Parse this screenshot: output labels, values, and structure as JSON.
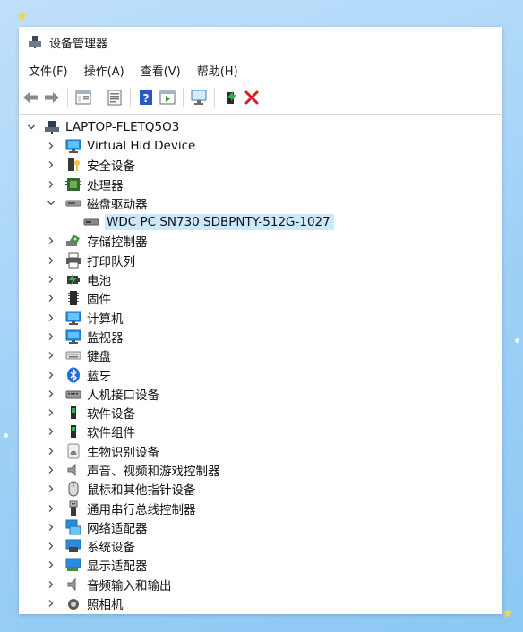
{
  "window": {
    "title": "设备管理器"
  },
  "menu": [
    "文件(F)",
    "操作(A)",
    "查看(V)",
    "帮助(H)"
  ],
  "toolbar": {
    "buttons": [
      "back-icon",
      "forward-icon",
      "properties-icon",
      "update-driver-icon",
      "help-icon",
      "run-icon",
      "scan-hardware-icon",
      "enable-device-icon",
      "uninstall-icon"
    ]
  },
  "tree": {
    "root": "LAPTOP-FLETQ5O3",
    "items": [
      {
        "label": "Virtual Hid Device",
        "icon": "monitor-icon",
        "state": "collapsed"
      },
      {
        "label": "安全设备",
        "icon": "security-device-icon",
        "state": "collapsed"
      },
      {
        "label": "处理器",
        "icon": "processor-icon",
        "state": "collapsed"
      },
      {
        "label": "磁盘驱动器",
        "icon": "disk-drive-icon",
        "state": "expanded"
      },
      {
        "label": "WDC PC SN730 SDBPNTY-512G-1027",
        "icon": "disk-icon",
        "state": "child"
      },
      {
        "label": "存储控制器",
        "icon": "storage-controller-icon",
        "state": "collapsed"
      },
      {
        "label": "打印队列",
        "icon": "printer-icon",
        "state": "collapsed"
      },
      {
        "label": "电池",
        "icon": "battery-icon",
        "state": "collapsed"
      },
      {
        "label": "固件",
        "icon": "firmware-icon",
        "state": "collapsed"
      },
      {
        "label": "计算机",
        "icon": "computer-icon",
        "state": "collapsed"
      },
      {
        "label": "监视器",
        "icon": "monitor-icon",
        "state": "collapsed"
      },
      {
        "label": "键盘",
        "icon": "keyboard-icon",
        "state": "collapsed"
      },
      {
        "label": "蓝牙",
        "icon": "bluetooth-icon",
        "state": "collapsed"
      },
      {
        "label": "人机接口设备",
        "icon": "hid-icon",
        "state": "collapsed"
      },
      {
        "label": "软件设备",
        "icon": "software-device-icon",
        "state": "collapsed"
      },
      {
        "label": "软件组件",
        "icon": "software-component-icon",
        "state": "collapsed"
      },
      {
        "label": "生物识别设备",
        "icon": "fingerprint-icon",
        "state": "collapsed"
      },
      {
        "label": "声音、视频和游戏控制器",
        "icon": "speaker-icon",
        "state": "collapsed"
      },
      {
        "label": "鼠标和其他指针设备",
        "icon": "mouse-icon",
        "state": "collapsed"
      },
      {
        "label": "通用串行总线控制器",
        "icon": "usb-icon",
        "state": "collapsed"
      },
      {
        "label": "网络适配器",
        "icon": "network-icon",
        "state": "collapsed"
      },
      {
        "label": "系统设备",
        "icon": "system-device-icon",
        "state": "collapsed"
      },
      {
        "label": "显示适配器",
        "icon": "display-adapter-icon",
        "state": "collapsed"
      },
      {
        "label": "音频输入和输出",
        "icon": "audio-icon",
        "state": "collapsed"
      },
      {
        "label": "照相机",
        "icon": "camera-icon",
        "state": "collapsed"
      }
    ]
  },
  "colors": {
    "selection": "#cce8ff",
    "accent": "#0a7ad6",
    "delete": "#d32020"
  }
}
